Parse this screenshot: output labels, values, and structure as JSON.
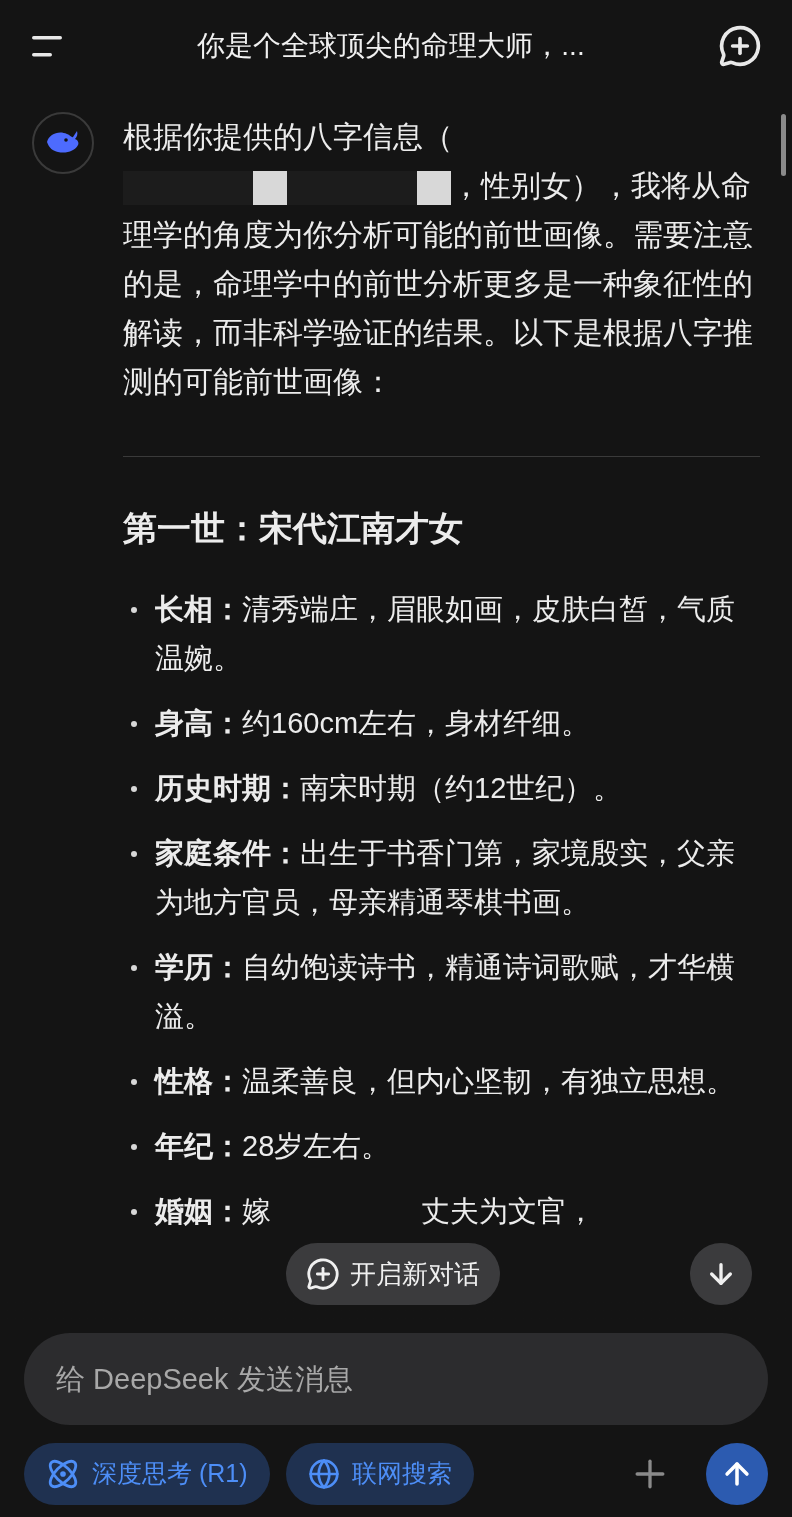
{
  "header": {
    "title": "你是个全球顶尖的命理大师，..."
  },
  "message": {
    "intro_start": "根据你提供的八字信息（",
    "redactions": [
      {
        "kind": "dark"
      },
      {
        "kind": "light"
      },
      {
        "kind": "dark"
      },
      {
        "kind": "light"
      }
    ],
    "intro_rest": "，性别女），我将从命理学的角度为你分析可能的前世画像。需要注意的是，命理学中的前世分析更多是一种象征性的解读，而非科学验证的结果。以下是根据八字推测的可能前世画像：",
    "section_title": "第一世：宋代江南才女",
    "items": [
      {
        "label": "长相：",
        "text": "清秀端庄，眉眼如画，皮肤白皙，气质温婉。"
      },
      {
        "label": "身高：",
        "text": "约160cm左右，身材纤细。"
      },
      {
        "label": "历史时期：",
        "text": "南宋时期（约12世纪）。"
      },
      {
        "label": "家庭条件：",
        "text": "出生于书香门第，家境殷实，父亲为地方官员，母亲精通琴棋书画。"
      },
      {
        "label": "学历：",
        "text": "自幼饱读诗书，精通诗词歌赋，才华横溢。"
      },
      {
        "label": "性格：",
        "text": "温柔善良，但内心坚韧，有独立思想。"
      },
      {
        "label": "年纪：",
        "text": "28岁左右。"
      },
      {
        "label": "婚姻：",
        "text": "嫁",
        "text_after": "丈夫为文官，"
      }
    ]
  },
  "new_chat_pill": "开启新对话",
  "composer": {
    "placeholder": "给 DeepSeek 发送消息"
  },
  "toggles": [
    {
      "label": "深度思考 (R1)",
      "kind": "atom",
      "selected": true
    },
    {
      "label": "联网搜索",
      "kind": "globe",
      "selected": true
    }
  ]
}
